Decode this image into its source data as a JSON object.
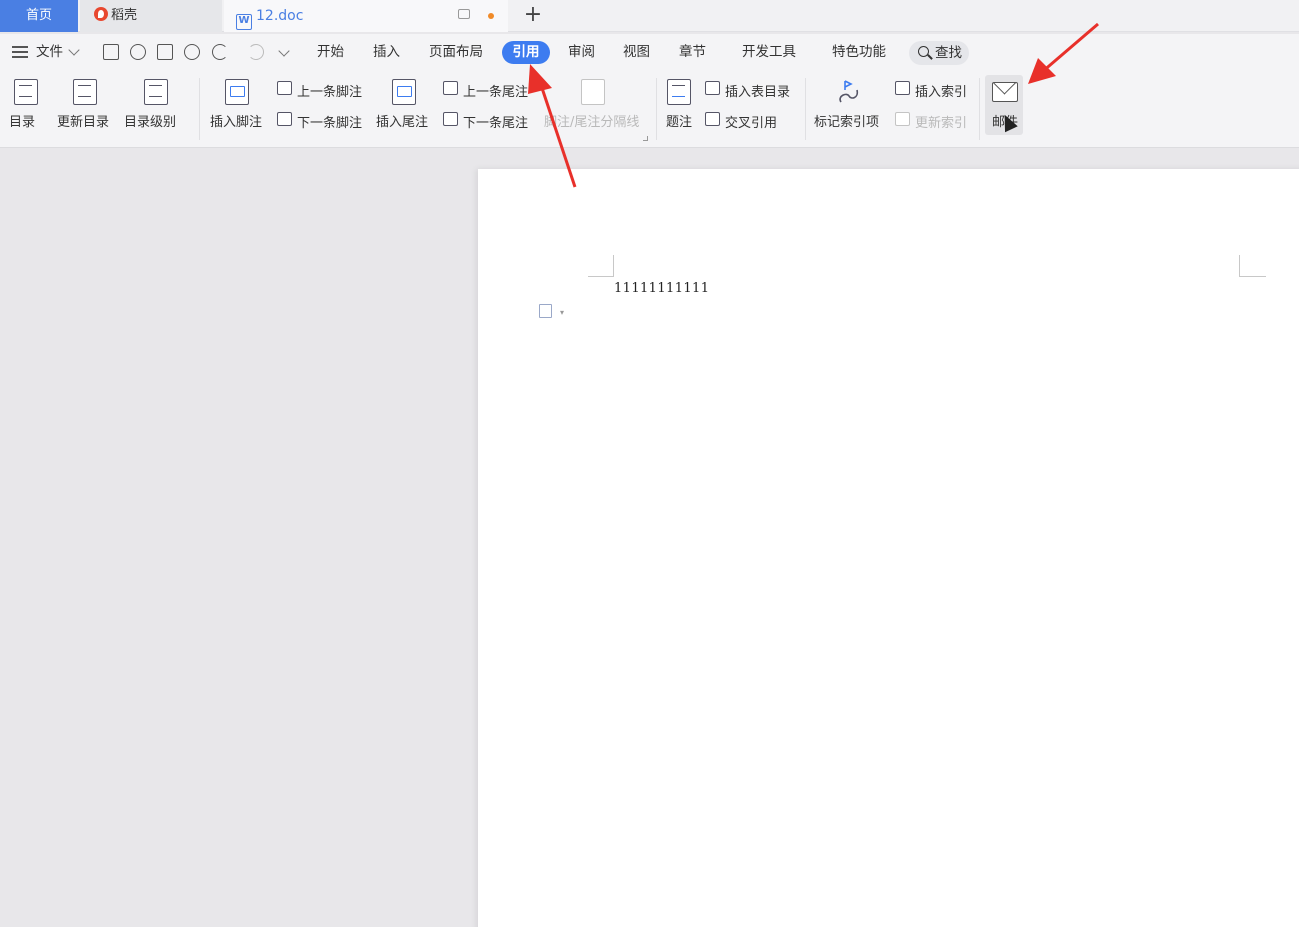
{
  "tabs": {
    "home": "首页",
    "daoke": "稻壳",
    "doc": "12.doc",
    "new_tab": "+"
  },
  "menu": {
    "file": "文件",
    "items": [
      "开始",
      "插入",
      "页面布局",
      "引用",
      "审阅",
      "视图",
      "章节",
      "开发工具",
      "特色功能"
    ],
    "active": "引用",
    "search": "查找"
  },
  "ribbon": {
    "toc": "目录",
    "update_toc": "更新目录",
    "toc_level": "目录级别",
    "insert_footnote": "插入脚注",
    "prev_footnote": "上一条脚注",
    "next_footnote": "下一条脚注",
    "insert_endnote": "插入尾注",
    "prev_endnote": "上一条尾注",
    "next_endnote": "下一条尾注",
    "note_separator": "脚注/尾注分隔线",
    "caption": "题注",
    "insert_table_of_figures": "插入表目录",
    "cross_reference": "交叉引用",
    "mark_index_entry": "标记索引项",
    "insert_index": "插入索引",
    "update_index": "更新索引",
    "mail": "邮件"
  },
  "document": {
    "text": "11111111111"
  },
  "colors": {
    "accent": "#3d7cf0",
    "home_tab": "#4a7fe3",
    "annotation_arrow": "#e8302a"
  }
}
